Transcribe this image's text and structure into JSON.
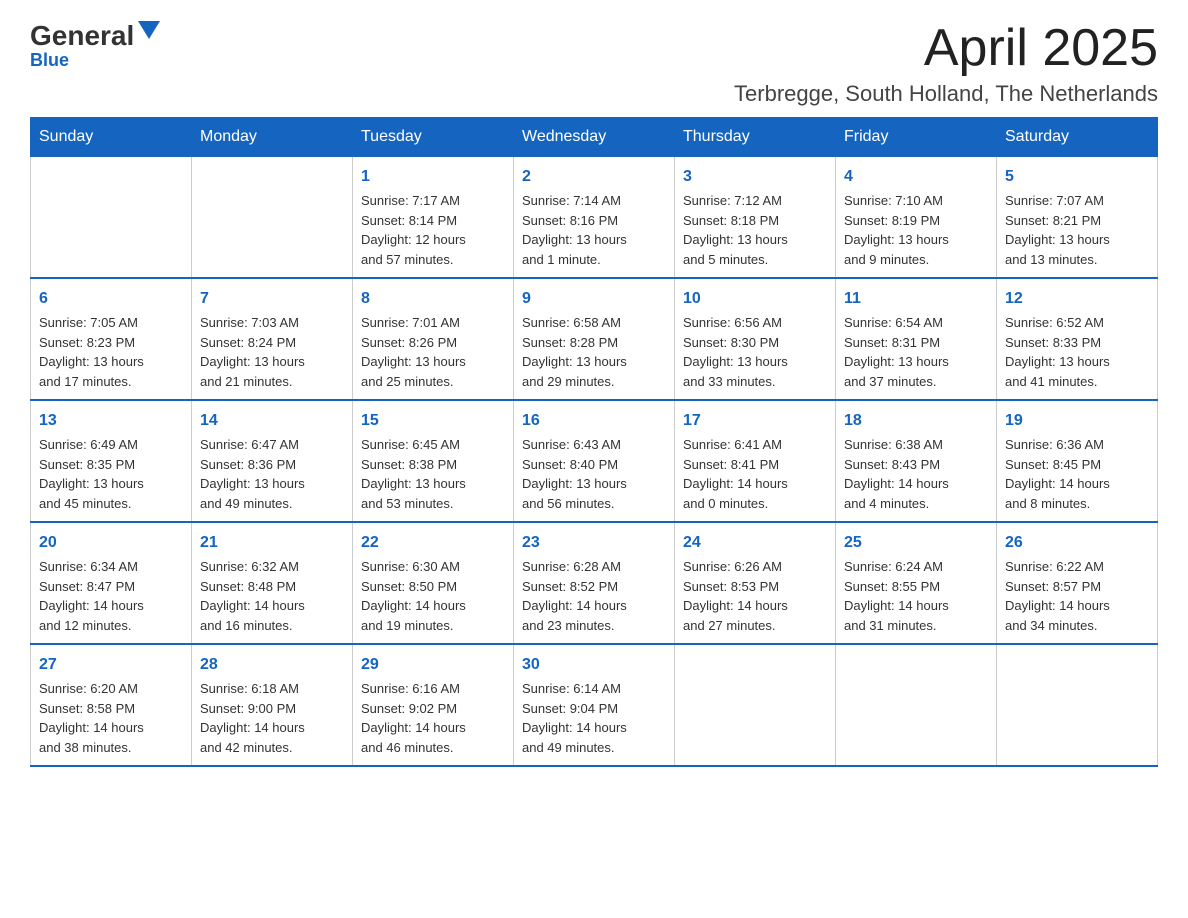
{
  "header": {
    "logo_general": "General",
    "logo_blue": "Blue",
    "month_title": "April 2025",
    "location": "Terbregge, South Holland, The Netherlands"
  },
  "days_of_week": [
    "Sunday",
    "Monday",
    "Tuesday",
    "Wednesday",
    "Thursday",
    "Friday",
    "Saturday"
  ],
  "weeks": [
    [
      {
        "num": "",
        "info": ""
      },
      {
        "num": "",
        "info": ""
      },
      {
        "num": "1",
        "info": "Sunrise: 7:17 AM\nSunset: 8:14 PM\nDaylight: 12 hours\nand 57 minutes."
      },
      {
        "num": "2",
        "info": "Sunrise: 7:14 AM\nSunset: 8:16 PM\nDaylight: 13 hours\nand 1 minute."
      },
      {
        "num": "3",
        "info": "Sunrise: 7:12 AM\nSunset: 8:18 PM\nDaylight: 13 hours\nand 5 minutes."
      },
      {
        "num": "4",
        "info": "Sunrise: 7:10 AM\nSunset: 8:19 PM\nDaylight: 13 hours\nand 9 minutes."
      },
      {
        "num": "5",
        "info": "Sunrise: 7:07 AM\nSunset: 8:21 PM\nDaylight: 13 hours\nand 13 minutes."
      }
    ],
    [
      {
        "num": "6",
        "info": "Sunrise: 7:05 AM\nSunset: 8:23 PM\nDaylight: 13 hours\nand 17 minutes."
      },
      {
        "num": "7",
        "info": "Sunrise: 7:03 AM\nSunset: 8:24 PM\nDaylight: 13 hours\nand 21 minutes."
      },
      {
        "num": "8",
        "info": "Sunrise: 7:01 AM\nSunset: 8:26 PM\nDaylight: 13 hours\nand 25 minutes."
      },
      {
        "num": "9",
        "info": "Sunrise: 6:58 AM\nSunset: 8:28 PM\nDaylight: 13 hours\nand 29 minutes."
      },
      {
        "num": "10",
        "info": "Sunrise: 6:56 AM\nSunset: 8:30 PM\nDaylight: 13 hours\nand 33 minutes."
      },
      {
        "num": "11",
        "info": "Sunrise: 6:54 AM\nSunset: 8:31 PM\nDaylight: 13 hours\nand 37 minutes."
      },
      {
        "num": "12",
        "info": "Sunrise: 6:52 AM\nSunset: 8:33 PM\nDaylight: 13 hours\nand 41 minutes."
      }
    ],
    [
      {
        "num": "13",
        "info": "Sunrise: 6:49 AM\nSunset: 8:35 PM\nDaylight: 13 hours\nand 45 minutes."
      },
      {
        "num": "14",
        "info": "Sunrise: 6:47 AM\nSunset: 8:36 PM\nDaylight: 13 hours\nand 49 minutes."
      },
      {
        "num": "15",
        "info": "Sunrise: 6:45 AM\nSunset: 8:38 PM\nDaylight: 13 hours\nand 53 minutes."
      },
      {
        "num": "16",
        "info": "Sunrise: 6:43 AM\nSunset: 8:40 PM\nDaylight: 13 hours\nand 56 minutes."
      },
      {
        "num": "17",
        "info": "Sunrise: 6:41 AM\nSunset: 8:41 PM\nDaylight: 14 hours\nand 0 minutes."
      },
      {
        "num": "18",
        "info": "Sunrise: 6:38 AM\nSunset: 8:43 PM\nDaylight: 14 hours\nand 4 minutes."
      },
      {
        "num": "19",
        "info": "Sunrise: 6:36 AM\nSunset: 8:45 PM\nDaylight: 14 hours\nand 8 minutes."
      }
    ],
    [
      {
        "num": "20",
        "info": "Sunrise: 6:34 AM\nSunset: 8:47 PM\nDaylight: 14 hours\nand 12 minutes."
      },
      {
        "num": "21",
        "info": "Sunrise: 6:32 AM\nSunset: 8:48 PM\nDaylight: 14 hours\nand 16 minutes."
      },
      {
        "num": "22",
        "info": "Sunrise: 6:30 AM\nSunset: 8:50 PM\nDaylight: 14 hours\nand 19 minutes."
      },
      {
        "num": "23",
        "info": "Sunrise: 6:28 AM\nSunset: 8:52 PM\nDaylight: 14 hours\nand 23 minutes."
      },
      {
        "num": "24",
        "info": "Sunrise: 6:26 AM\nSunset: 8:53 PM\nDaylight: 14 hours\nand 27 minutes."
      },
      {
        "num": "25",
        "info": "Sunrise: 6:24 AM\nSunset: 8:55 PM\nDaylight: 14 hours\nand 31 minutes."
      },
      {
        "num": "26",
        "info": "Sunrise: 6:22 AM\nSunset: 8:57 PM\nDaylight: 14 hours\nand 34 minutes."
      }
    ],
    [
      {
        "num": "27",
        "info": "Sunrise: 6:20 AM\nSunset: 8:58 PM\nDaylight: 14 hours\nand 38 minutes."
      },
      {
        "num": "28",
        "info": "Sunrise: 6:18 AM\nSunset: 9:00 PM\nDaylight: 14 hours\nand 42 minutes."
      },
      {
        "num": "29",
        "info": "Sunrise: 6:16 AM\nSunset: 9:02 PM\nDaylight: 14 hours\nand 46 minutes."
      },
      {
        "num": "30",
        "info": "Sunrise: 6:14 AM\nSunset: 9:04 PM\nDaylight: 14 hours\nand 49 minutes."
      },
      {
        "num": "",
        "info": ""
      },
      {
        "num": "",
        "info": ""
      },
      {
        "num": "",
        "info": ""
      }
    ]
  ]
}
